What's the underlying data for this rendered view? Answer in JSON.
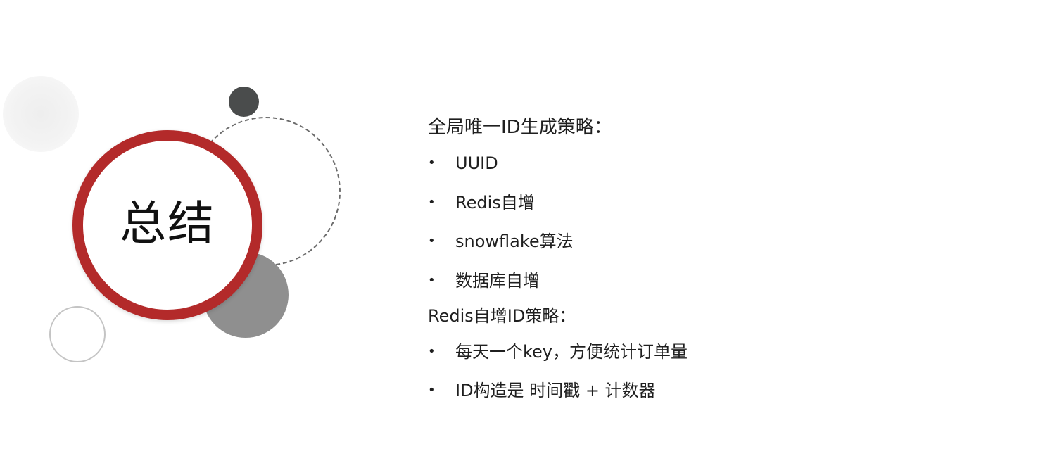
{
  "slide": {
    "title": "总结",
    "sections": [
      {
        "heading": "全局唯一ID生成策略：",
        "items": [
          "UUID",
          "Redis自增",
          "snowflake算法",
          "数据库自增"
        ]
      },
      {
        "heading": "Redis自增ID策略：",
        "items": [
          "每天一个key，方便统计订单量",
          "ID构造是 时间戳 + 计数器"
        ]
      }
    ],
    "bullet_symbol": "•"
  },
  "colors": {
    "accent_ring": "#b32a2a",
    "dark_dot": "#4a4c4c",
    "gray_circle": "#8f8f8f"
  }
}
